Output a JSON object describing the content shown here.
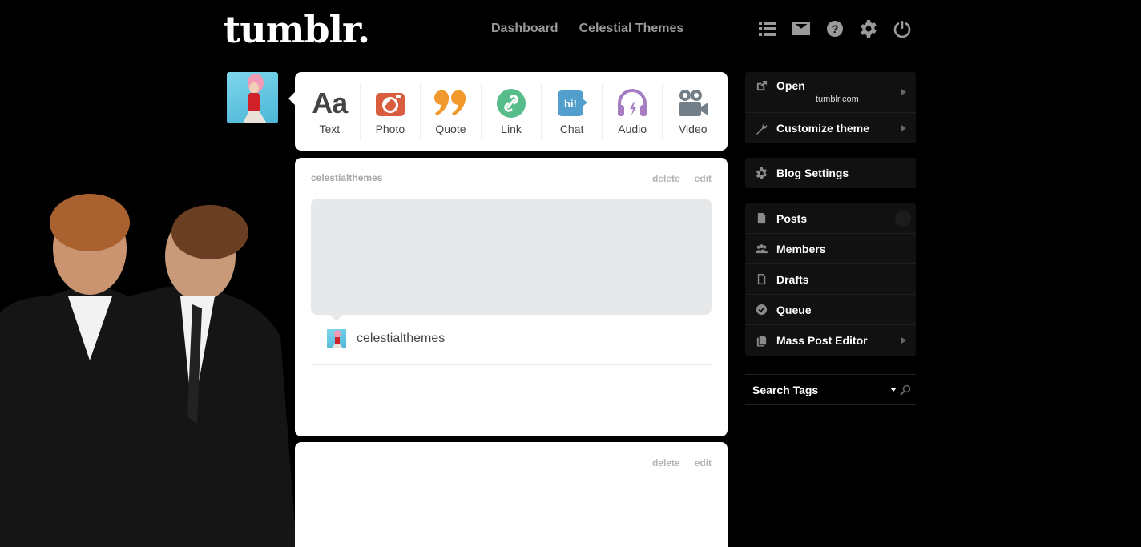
{
  "header": {
    "logo": "tumblr.",
    "nav": [
      "Dashboard",
      "Celestial Themes"
    ],
    "icons": [
      "list-icon",
      "mail-icon",
      "help-icon",
      "gear-icon",
      "power-icon"
    ]
  },
  "post_types": [
    {
      "label": "Text",
      "icon": "text-icon",
      "glyph": "Aa",
      "color": "#444444"
    },
    {
      "label": "Photo",
      "icon": "camera-icon",
      "color": "#d95e40"
    },
    {
      "label": "Quote",
      "icon": "quote-icon",
      "color": "#f2992e"
    },
    {
      "label": "Link",
      "icon": "link-icon",
      "color": "#56bc8a"
    },
    {
      "label": "Chat",
      "icon": "chat-icon",
      "glyph": "hi!",
      "color": "#529ecc"
    },
    {
      "label": "Audio",
      "icon": "headphones-icon",
      "color": "#a77dc2"
    },
    {
      "label": "Video",
      "icon": "video-camera-icon",
      "color": "#748089"
    }
  ],
  "posts": [
    {
      "blog": "celestialthemes",
      "actions": [
        "delete",
        "edit"
      ],
      "source": "celestialthemes"
    },
    {
      "blog": "",
      "actions": [
        "delete",
        "edit"
      ]
    }
  ],
  "sidebar": {
    "group1": [
      {
        "label": "Open",
        "sub": "tumblr.com",
        "icon": "external-link-icon"
      },
      {
        "label": "Customize theme",
        "icon": "wrench-icon"
      }
    ],
    "group2": [
      {
        "label": "Blog Settings",
        "icon": "gear-icon"
      }
    ],
    "group3": [
      {
        "label": "Posts",
        "icon": "document-icon"
      },
      {
        "label": "Members",
        "icon": "members-icon"
      },
      {
        "label": "Drafts",
        "icon": "draft-icon"
      },
      {
        "label": "Queue",
        "icon": "check-circle-icon"
      },
      {
        "label": "Mass Post Editor",
        "icon": "documents-icon"
      }
    ],
    "search_tags": "Search Tags"
  }
}
